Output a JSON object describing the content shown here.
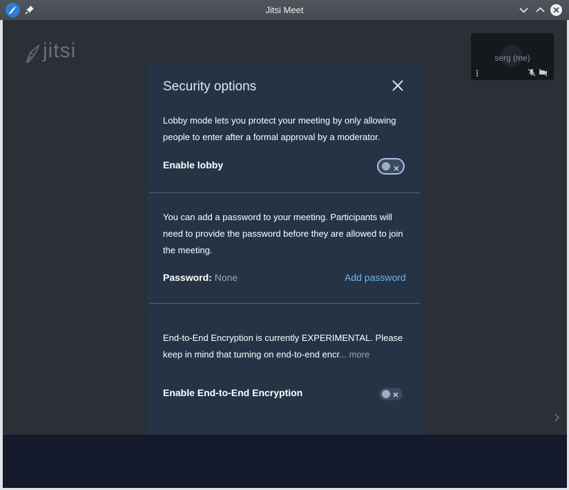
{
  "window": {
    "title": "Jitsi Meet"
  },
  "logo": {
    "text": "jitsi"
  },
  "thumbnail": {
    "name": "serg (me)"
  },
  "dialog": {
    "title": "Security options",
    "lobby": {
      "description": "Lobby mode lets you protect your meeting by only allowing people to enter after a formal approval by a moderator.",
      "label": "Enable lobby",
      "enabled": false
    },
    "password": {
      "description": "You can add a password to your meeting. Participants will need to provide the password before they are allowed to join the meeting.",
      "label": "Password:",
      "value": "None",
      "add_label": "Add password"
    },
    "e2ee": {
      "description": "End-to-End Encryption is currently EXPERIMENTAL. Please keep in mind that turning on end-to-end encr",
      "more_label": "... more",
      "label": "Enable End-to-End Encryption",
      "enabled": false
    }
  },
  "colors": {
    "dialog_bg": "#253345",
    "link": "#6eb6f0",
    "stage_bg": "#2b2f36",
    "toolbar_bg": "#141a2b"
  },
  "icons": [
    "jitsi-app-icon",
    "pin-icon",
    "minimize-icon",
    "maximize-icon",
    "close-icon",
    "jitsi-logo-icon",
    "more-vertical-icon",
    "mic-muted-icon",
    "camera-off-icon",
    "chevron-right-icon",
    "toggle-x-icon"
  ]
}
